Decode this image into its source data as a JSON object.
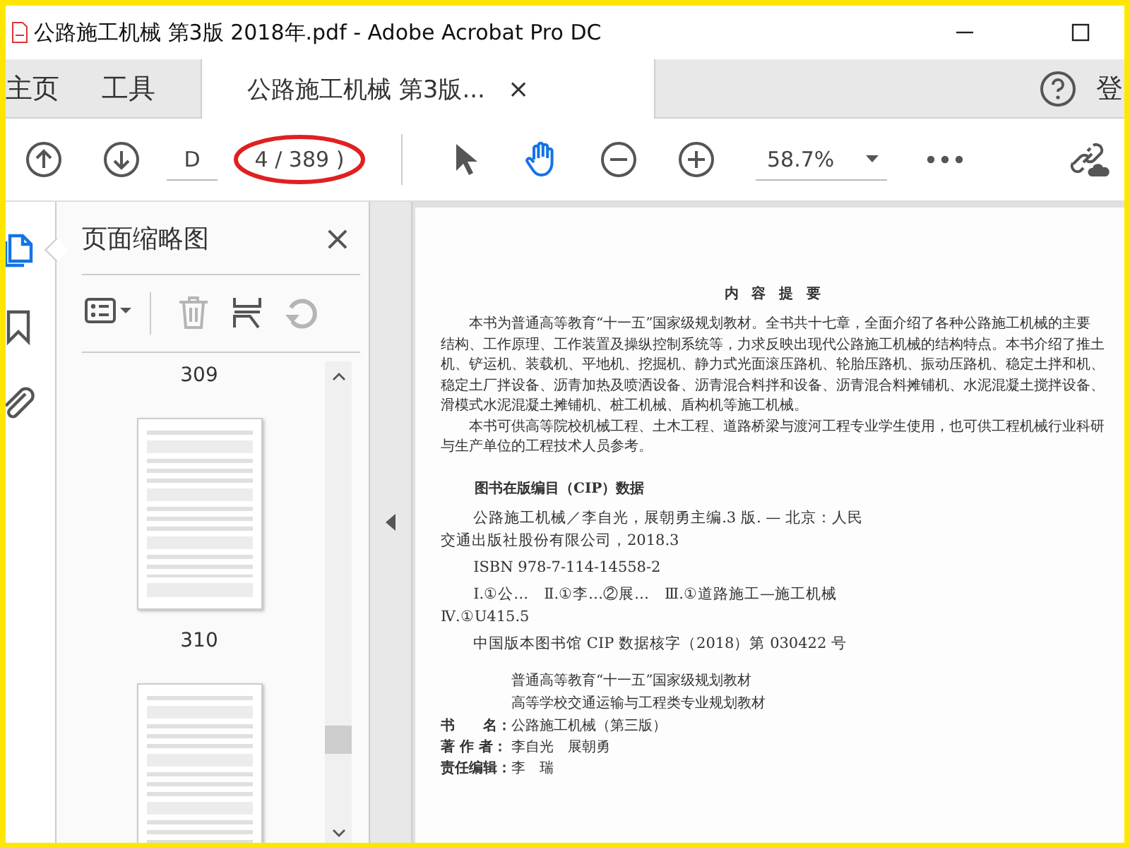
{
  "window": {
    "title": "公路施工机械 第3版 2018年.pdf - Adobe Acrobat Pro DC"
  },
  "tabs": [
    {
      "label": "主页",
      "kind": "home",
      "selected": false
    },
    {
      "label": "工具",
      "kind": "tools",
      "selected": false
    },
    {
      "label": "公路施工机械 第3版...",
      "kind": "document",
      "selected": true,
      "close": "×"
    }
  ],
  "account_label": "登",
  "toolbar": {
    "page_field": {
      "value": "D"
    },
    "page_count": "4 / 389 )",
    "page_count_circled": true,
    "tools": [
      {
        "kind": "select",
        "selected": false
      },
      {
        "kind": "hand",
        "selected": true
      }
    ],
    "zoom": "58.7%"
  },
  "side_rail": [
    {
      "kind": "pages",
      "selected": true
    },
    {
      "kind": "bookmarks",
      "selected": false
    },
    {
      "kind": "attachments",
      "selected": false
    }
  ],
  "panel": {
    "title": "页面缩略图",
    "close": "×",
    "tools": [
      {
        "kind": "options",
        "disabled": false
      },
      {
        "kind": "delete",
        "disabled": true
      },
      {
        "kind": "extract",
        "disabled": false
      },
      {
        "kind": "rotate",
        "disabled": true
      }
    ],
    "thumbnails": [
      {
        "label": "309"
      },
      {
        "label": "310"
      }
    ]
  },
  "page": {
    "heading": "内 容 提 要",
    "paragraphs": [
      "本书为普通高等教育“十一五”国家级规划教材。全书共十七章，全面介绍了各种公路施工机械的主要结构、工作原理、工作装置及操纵控制系统等，力求反映出现代公路施工机械的结构特点。本书介绍了推土机、铲运机、装载机、平地机、挖掘机、静力式光面滚压路机、轮胎压路机、振动压路机、稳定土拌和机、稳定土厂拌设备、沥青加热及喷洒设备、沥青混合料拌和设备、沥青混合料摊铺机、水泥混凝土搅拌设备、滑模式水泥混凝土摊铺机、桩工机械、盾构机等施工机械。",
      "本书可供高等院校机械工程、土木工程、道路桥梁与渡河工程专业学生使用，也可供工程机械行业科研与生产单位的工程技术人员参考。"
    ],
    "cip_heading": "图书在版编目（CIP）数据",
    "cip_lines": [
      "公路施工机械／李自光，展朝勇主编.3 版. — 北京：人民交通出版社股份有限公司，2018.3",
      "ISBN 978-7-114-14558-2",
      "Ⅰ.①公…　Ⅱ.①李…②展…　Ⅲ.①道路施工—施工机械　Ⅳ.①U415.5",
      "中国版本图书馆 CIP 数据核字（2018）第 030422 号"
    ],
    "series": [
      "普通高等教育“十一五”国家级规划教材",
      "高等学校交通运输与工程类专业规划教材"
    ],
    "details": [
      {
        "key": "书　　名：",
        "value": "公路施工机械（第三版）"
      },
      {
        "key": "著 作 者：",
        "value": "李自光　展朝勇"
      },
      {
        "key": "责任编辑：",
        "value": "李　瑞"
      }
    ]
  }
}
